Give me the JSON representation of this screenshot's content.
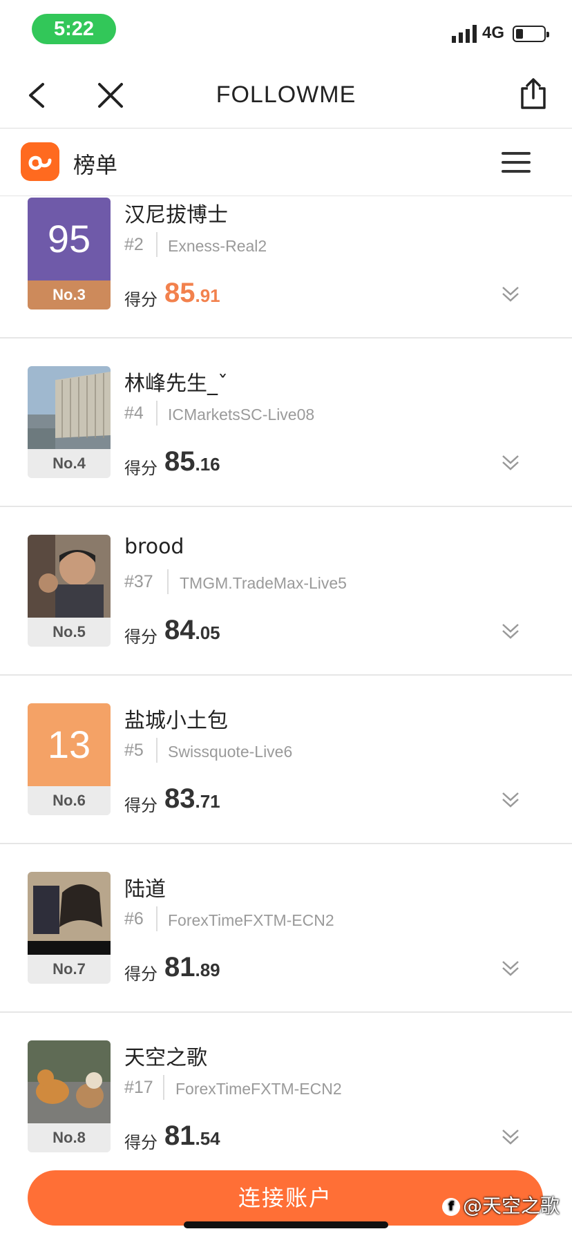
{
  "status": {
    "time": "5:22",
    "network": "4G"
  },
  "nav": {
    "title": "FOLLOWME"
  },
  "section": {
    "title": "榜单"
  },
  "entries": [
    {
      "name": "汉尼拔博士",
      "hash": "#2",
      "server": "Exness-Real2",
      "score_label": "得分",
      "score_int": "85",
      "score_dec": ".91",
      "rank": "No.3",
      "avatar_text": "95",
      "avatar_color": "#6f5aa9"
    },
    {
      "name": "林峰先生_ˇ",
      "hash": "#4",
      "server": "ICMarketsSC-Live08",
      "score_label": "得分",
      "score_int": "85",
      "score_dec": ".16",
      "rank": "No.4"
    },
    {
      "name": "brood",
      "hash": "#37",
      "server": "TMGM.TradeMax-Live5",
      "score_label": "得分",
      "score_int": "84",
      "score_dec": ".05",
      "rank": "No.5"
    },
    {
      "name": "盐城小土包",
      "hash": "#5",
      "server": "Swissquote-Live6",
      "score_label": "得分",
      "score_int": "83",
      "score_dec": ".71",
      "rank": "No.6",
      "avatar_text": "13",
      "avatar_color": "#f4a266"
    },
    {
      "name": "陆道",
      "hash": "#6",
      "server": "ForexTimeFXTM-ECN2",
      "score_label": "得分",
      "score_int": "81",
      "score_dec": ".89",
      "rank": "No.7"
    },
    {
      "name": "天空之歌",
      "hash": "#17",
      "server": "ForexTimeFXTM-ECN2",
      "score_label": "得分",
      "score_int": "81",
      "score_dec": ".54",
      "rank": "No.8"
    }
  ],
  "bottom": {
    "connect_label": "连接账户",
    "watermark": "@天空之歌"
  },
  "colors": {
    "accent": "#ff6f36",
    "highlight_score": "#f2814d",
    "status_green": "#32c759"
  },
  "icons": {
    "back": "chevron-left-icon",
    "close": "close-icon",
    "share": "share-icon",
    "menu": "hamburger-menu-icon",
    "expand": "double-chevron-down-icon"
  }
}
